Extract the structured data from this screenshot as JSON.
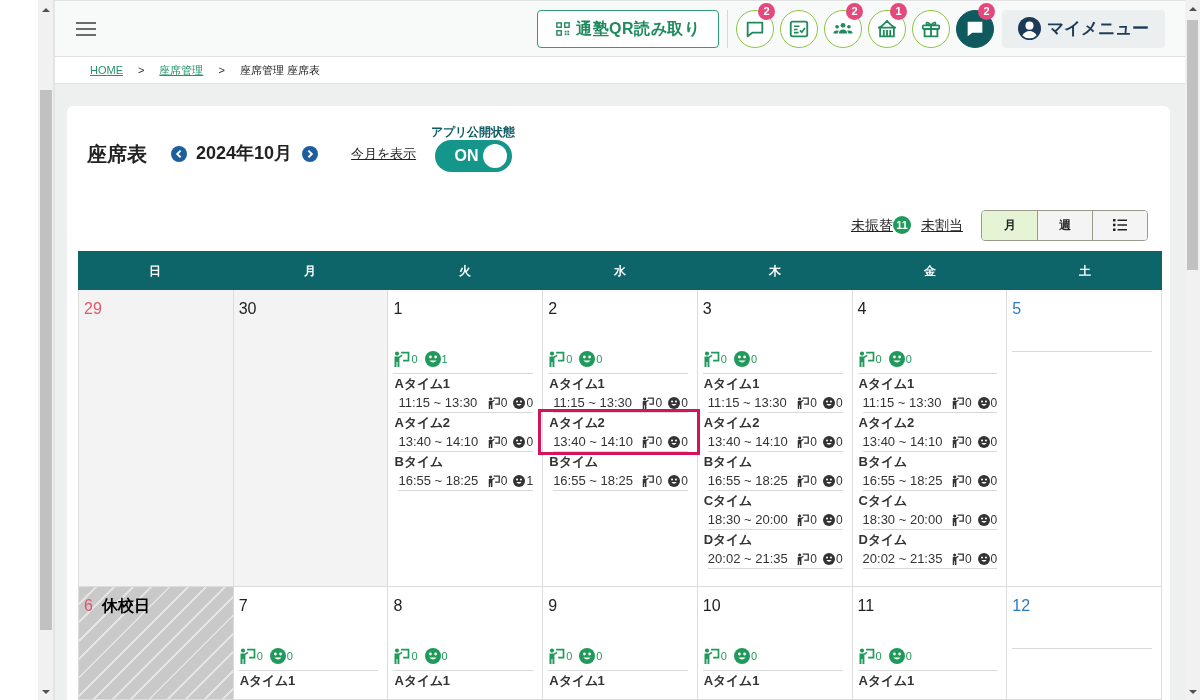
{
  "header": {
    "qr_button": {
      "label": "通塾QR読み取り"
    },
    "icon_buttons": [
      {
        "kind": "outline",
        "badge": "2"
      },
      {
        "kind": "outline"
      },
      {
        "kind": "outline",
        "badge": "2"
      },
      {
        "kind": "outline",
        "badge": "1"
      },
      {
        "kind": "outline"
      },
      {
        "kind": "filled",
        "badge": "2"
      }
    ],
    "my_menu": {
      "label": "マイメニュー"
    }
  },
  "breadcrumb": [
    {
      "label": "HOME",
      "link": true
    },
    {
      "separator": ">",
      "label": "座席管理",
      "link": true
    },
    {
      "separator": ">",
      "label": "座席管理 座席表",
      "link": false
    }
  ],
  "page": {
    "title": "座席表",
    "month": "2024年10月",
    "today_link": "今月を表示",
    "publish": {
      "label": "アプリ公開状態",
      "on": true,
      "text": "ON"
    }
  },
  "filters": [
    {
      "label": "未振替",
      "badge": "11"
    },
    {
      "label": "未割当"
    }
  ],
  "view_switch": [
    {
      "kind": "text",
      "label": "月",
      "selected": true
    },
    {
      "kind": "text",
      "label": "週",
      "selected": false
    },
    {
      "kind": "list_icon",
      "selected": false
    }
  ],
  "calendar": {
    "weekdays": [
      "日",
      "月",
      "火",
      "水",
      "木",
      "金",
      "土"
    ],
    "weeks": [
      {
        "days": [
          {
            "date": "29",
            "other_month": true
          },
          {
            "date": "30",
            "other_month": true
          },
          {
            "date": "1",
            "summary": {
              "teachers": "0",
              "students": "1"
            },
            "slots": [
              {
                "name": "Aタイム1",
                "time": "11:15 ~ 13:30",
                "teachers": "0",
                "students": "0",
                "selected": false
              },
              {
                "name": "Aタイム2",
                "time": "13:40 ~ 14:10",
                "teachers": "0",
                "students": "0",
                "selected": false
              },
              {
                "name": "Bタイム",
                "time": "16:55 ~ 18:25",
                "teachers": "0",
                "students": "1",
                "selected": false
              }
            ]
          },
          {
            "date": "2",
            "summary": {
              "teachers": "0",
              "students": "0"
            },
            "slots": [
              {
                "name": "Aタイム1",
                "time": "11:15 ~ 13:30",
                "teachers": "0",
                "students": "0",
                "selected": false
              },
              {
                "name": "Aタイム2",
                "time": "13:40 ~ 14:10",
                "teachers": "0",
                "students": "0",
                "selected": true
              },
              {
                "name": "Bタイム",
                "time": "16:55 ~ 18:25",
                "teachers": "0",
                "students": "0",
                "selected": false
              }
            ]
          },
          {
            "date": "3",
            "summary": {
              "teachers": "0",
              "students": "0"
            },
            "slots": [
              {
                "name": "Aタイム1",
                "time": "11:15 ~ 13:30",
                "teachers": "0",
                "students": "0",
                "selected": false
              },
              {
                "name": "Aタイム2",
                "time": "13:40 ~ 14:10",
                "teachers": "0",
                "students": "0",
                "selected": false
              },
              {
                "name": "Bタイム",
                "time": "16:55 ~ 18:25",
                "teachers": "0",
                "students": "0",
                "selected": false
              },
              {
                "name": "Cタイム",
                "time": "18:30 ~ 20:00",
                "teachers": "0",
                "students": "0",
                "selected": false
              },
              {
                "name": "Dタイム",
                "time": "20:02 ~ 21:35",
                "teachers": "0",
                "students": "0",
                "selected": false
              }
            ]
          },
          {
            "date": "4",
            "summary": {
              "teachers": "0",
              "students": "0"
            },
            "slots": [
              {
                "name": "Aタイム1",
                "time": "11:15 ~ 13:30",
                "teachers": "0",
                "students": "0",
                "selected": false
              },
              {
                "name": "Aタイム2",
                "time": "13:40 ~ 14:10",
                "teachers": "0",
                "students": "0",
                "selected": false
              },
              {
                "name": "Bタイム",
                "time": "16:55 ~ 18:25",
                "teachers": "0",
                "students": "0",
                "selected": false
              },
              {
                "name": "Cタイム",
                "time": "18:30 ~ 20:00",
                "teachers": "0",
                "students": "0",
                "selected": false
              },
              {
                "name": "Dタイム",
                "time": "20:02 ~ 21:35",
                "teachers": "0",
                "students": "0",
                "selected": false
              }
            ]
          },
          {
            "date": "5"
          }
        ]
      },
      {
        "days": [
          {
            "date": "6",
            "closed": true,
            "note": "休校日"
          },
          {
            "date": "7",
            "summary": {
              "teachers": "0",
              "students": "0"
            },
            "slots": [
              {
                "name": "Aタイム1",
                "selected": false
              }
            ]
          },
          {
            "date": "8",
            "summary": {
              "teachers": "0",
              "students": "0"
            },
            "slots": [
              {
                "name": "Aタイム1",
                "selected": false
              }
            ]
          },
          {
            "date": "9",
            "summary": {
              "teachers": "0",
              "students": "0"
            },
            "slots": [
              {
                "name": "Aタイム1",
                "selected": false
              }
            ]
          },
          {
            "date": "10",
            "summary": {
              "teachers": "0",
              "students": "0"
            },
            "slots": [
              {
                "name": "Aタイム1",
                "selected": false
              }
            ]
          },
          {
            "date": "11",
            "summary": {
              "teachers": "0",
              "students": "0"
            },
            "slots": [
              {
                "name": "Aタイム1",
                "selected": false
              }
            ]
          },
          {
            "date": "12"
          }
        ]
      }
    ]
  }
}
